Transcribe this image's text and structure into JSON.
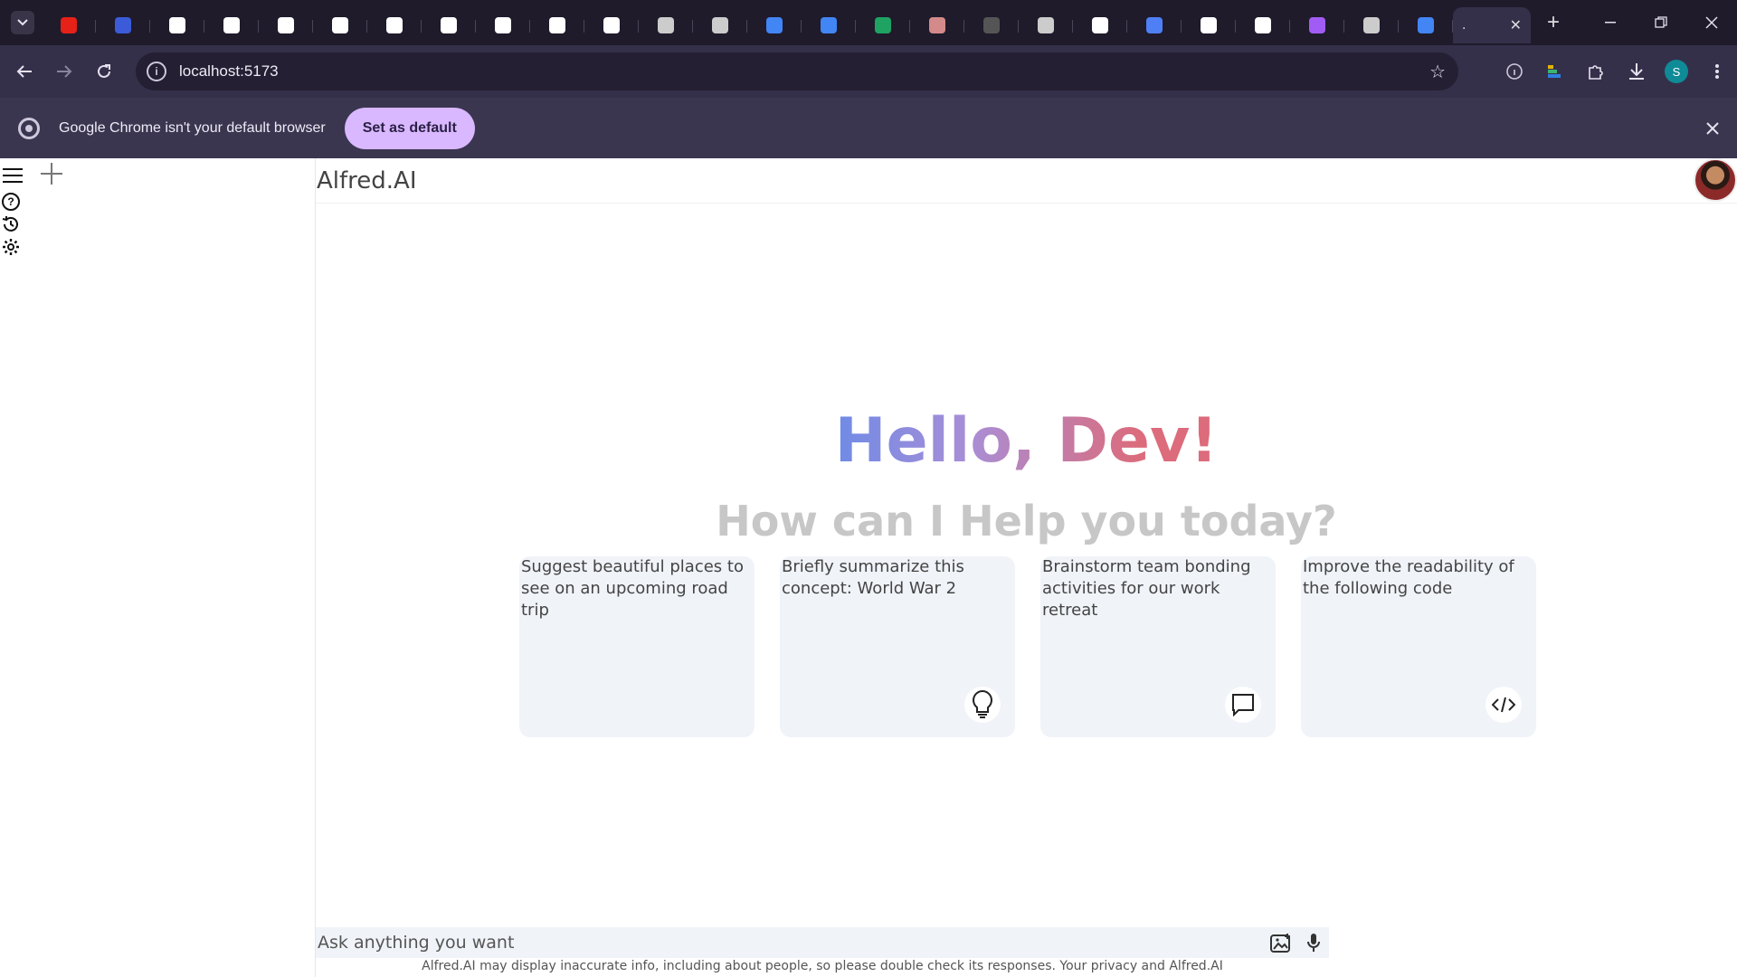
{
  "browser": {
    "tabs": [
      {
        "favicon": "youtube-icon",
        "color": "#e62117"
      },
      {
        "favicon": "app-icon",
        "color": "#3b5bd9"
      },
      {
        "favicon": "github-icon",
        "color": "#ffffff"
      },
      {
        "favicon": "a-logo-icon",
        "color": "#ffffff"
      },
      {
        "favicon": "a-logo-icon",
        "color": "#ffffff"
      },
      {
        "favicon": "b-logo-icon",
        "color": "#ffffff"
      },
      {
        "favicon": "b-logo-icon",
        "color": "#ffffff"
      },
      {
        "favicon": "a-logo-icon",
        "color": "#ffffff"
      },
      {
        "favicon": "b-logo-icon",
        "color": "#ffffff"
      },
      {
        "favicon": "a-logo-icon",
        "color": "#ffffff"
      },
      {
        "favicon": "a-logo-icon",
        "color": "#ffffff"
      },
      {
        "favicon": "openai-icon",
        "color": "#cccccc"
      },
      {
        "favicon": "globe-icon",
        "color": "#cccccc"
      },
      {
        "favicon": "google-icon",
        "color": "#4285f4"
      },
      {
        "favicon": "google-icon",
        "color": "#4285f4"
      },
      {
        "favicon": "sheets-icon",
        "color": "#1ea362"
      },
      {
        "favicon": "avatar-icon",
        "color": "#d48a8a"
      },
      {
        "favicon": "app-dark-icon",
        "color": "#555555"
      },
      {
        "favicon": "openai-icon",
        "color": "#cccccc"
      },
      {
        "favicon": "a-logo-icon",
        "color": "#ffffff"
      },
      {
        "favicon": "gemini-icon",
        "color": "#4f7ff5"
      },
      {
        "favicon": "github-icon",
        "color": "#ffffff"
      },
      {
        "favicon": "triangle-icon",
        "color": "#ffffff"
      },
      {
        "favicon": "vite-icon",
        "color": "#a25cf6"
      },
      {
        "favicon": "openai-icon",
        "color": "#cccccc"
      },
      {
        "favicon": "google-icon",
        "color": "#4285f4"
      }
    ],
    "active_tab_label": ".",
    "url": "localhost:5173",
    "profile_initial": "S",
    "infobar": {
      "message": "Google Chrome isn't your default browser",
      "button": "Set as default"
    }
  },
  "app": {
    "brand": "Alfred.AI",
    "greeting": "Hello, Dev!",
    "subtitle": "How can I Help you today?",
    "cards": [
      {
        "text": "Suggest beautiful places to see on an upcoming road trip",
        "icon": ""
      },
      {
        "text": "Briefly summarize this concept: World War 2",
        "icon": "lightbulb-icon"
      },
      {
        "text": "Brainstorm team bonding activities for our work retreat",
        "icon": "message-icon"
      },
      {
        "text": "Improve the readability of the following code",
        "icon": "code-icon"
      }
    ],
    "prompt_placeholder": "Ask anything you want",
    "disclaimer": "Alfred.AI may display inaccurate info, including about people, so please double check its responses. Your privacy and Alfred.AI"
  }
}
